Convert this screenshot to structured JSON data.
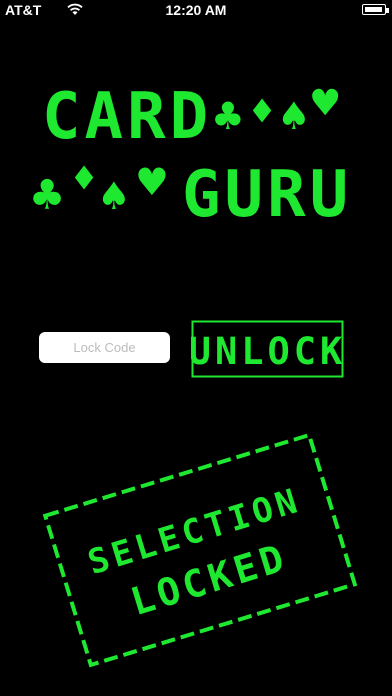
{
  "status_bar": {
    "carrier": "AT&T",
    "time": "12:20 AM"
  },
  "logo": {
    "line1": "CARD",
    "line2": "GURU",
    "suits": [
      "♣",
      "♦",
      "♠",
      "♥"
    ]
  },
  "lock_code": {
    "placeholder": "Lock Code",
    "value": ""
  },
  "unlock_button": {
    "label": "UNLOCK"
  },
  "stamp": {
    "line1": "SELECTION",
    "line2": "LOCKED"
  },
  "colors": {
    "accent": "#1ee82f",
    "background": "#000000"
  }
}
